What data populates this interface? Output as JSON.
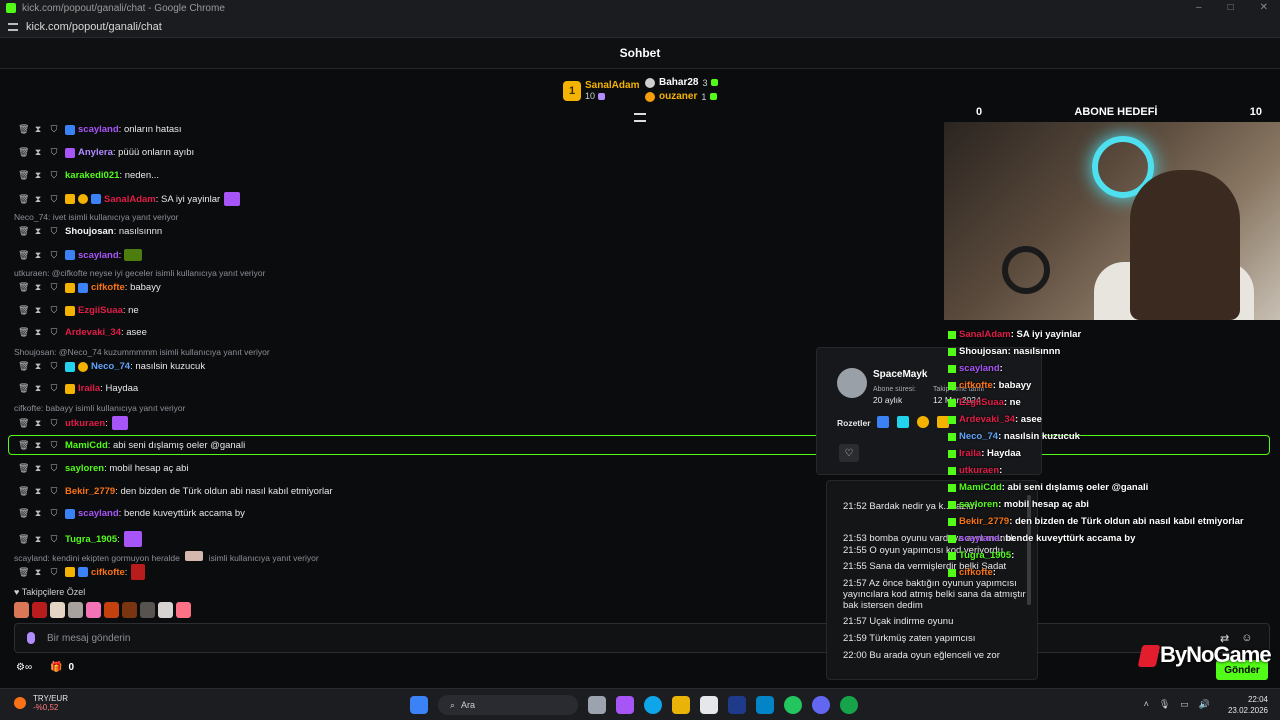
{
  "window": {
    "title": "kick.com/popout/ganali/chat - Google Chrome",
    "url": "kick.com/popout/ganali/chat",
    "controls": [
      "–",
      "□",
      "✕"
    ]
  },
  "chat_header": {
    "title": "Sohbet"
  },
  "top_gifters": {
    "main": {
      "name": "SanalAdam",
      "count": "10",
      "rank": "1"
    },
    "others": [
      {
        "name": "Bahar28",
        "count": "3"
      },
      {
        "name": "ouzaner",
        "count": "1"
      }
    ]
  },
  "messages": [
    {
      "user": "scayland",
      "user_color": "#a855f7",
      "text": ": onların hatası"
    },
    {
      "user": "Anylera",
      "user_color": "#b18cff",
      "text": ": püüü onların ayıbı"
    },
    {
      "user": "karakedi021",
      "user_color": "#53fc18",
      "text": ": neden..."
    },
    {
      "user": "SanalAdam",
      "user_color": "#e11d48",
      "text": ": SA iyi yayinlar"
    },
    {
      "user": "Shoujosan",
      "user_color": "#f5f5f5",
      "text": ": nasılsınnn"
    },
    {
      "user": "scayland",
      "user_color": "#a855f7",
      "text": ":"
    },
    {
      "user": "cifkofte",
      "user_color": "#f97316",
      "text": ": babayy"
    },
    {
      "user": "EzgiiSuaa",
      "user_color": "#e11d48",
      "text": ": ne"
    },
    {
      "user": "Ardevaki_34",
      "user_color": "#e11d48",
      "text": ": asee"
    },
    {
      "user": "Neco_74",
      "user_color": "#60a5fa",
      "text": ": nasılsin kuzucuk"
    },
    {
      "user": "Iraila",
      "user_color": "#e11d48",
      "text": ": Haydaa"
    },
    {
      "user": "utkuraen",
      "user_color": "#e11d48",
      "text": ":"
    },
    {
      "user": "MamiCdd",
      "user_color": "#53fc18",
      "text": ": abi seni dışlamış oeler @ganali"
    },
    {
      "user": "sayloren",
      "user_color": "#53fc18",
      "text": ": mobil hesap aç abi"
    },
    {
      "user": "Bekir_2779",
      "user_color": "#f97316",
      "text": ": den bizden de Türk oldun abi nasıl kabıl etmiyorlar"
    },
    {
      "user": "scayland",
      "user_color": "#a855f7",
      "text": ": bende kuveyttürk accama by"
    },
    {
      "user": "Tugra_1905",
      "user_color": "#53fc18",
      "text": ":"
    },
    {
      "user": "cifkofte",
      "user_color": "#f97316",
      "text": ":"
    }
  ],
  "replies": [
    "Neco_74: ivet isimli kullanıcıya yanıt veriyor",
    "utkuraen: @cifkofte neyse iyi geceler isimli kullanıcıya yanıt veriyor",
    "Shoujosan: @Neco_74 kuzummmmm isimli kullanıcıya yanıt veriyor",
    "cifkofte: babayy isimli kullanıcıya yanıt veriyor",
    "scayland: kendini ekipten gormuyon heralde",
    "isimli kullanıcıya yanıt veriyor"
  ],
  "followers_label": "Takipçilere Özel",
  "input": {
    "placeholder": "Bir mesaj gönderin"
  },
  "bottom": {
    "count": "0",
    "send_label": "Gönder"
  },
  "overlay": {
    "goal_left": "0",
    "goal_title": "ABONE HEDEFİ",
    "goal_right": "10",
    "chat": [
      {
        "user": "SanalAdam",
        "color": "#e11d48",
        "text": " : SA iyi yayinlar"
      },
      {
        "user": "Shoujosan",
        "color": "#ffffff",
        "text": " : nasılsınnn"
      },
      {
        "user": "scayland",
        "color": "#a855f7",
        "text": " :"
      },
      {
        "user": "cifkofte",
        "color": "#f97316",
        "text": " : babayy"
      },
      {
        "user": "EzgiiSuaa",
        "color": "#e11d48",
        "text": " : ne"
      },
      {
        "user": "Ardevaki_34",
        "color": "#e11d48",
        "text": " : asee"
      },
      {
        "user": "Neco_74",
        "color": "#60a5fa",
        "text": " : nasılsin kuzucuk"
      },
      {
        "user": "Iraila",
        "color": "#e11d48",
        "text": " : Haydaa"
      },
      {
        "user": "utkuraen",
        "color": "#e11d48",
        "text": " :"
      },
      {
        "user": "MamiCdd",
        "color": "#53fc18",
        "text": " : abi seni dışlamış oeler @ganali"
      },
      {
        "user": "sayloren",
        "color": "#53fc18",
        "text": " : mobil hesap aç abi"
      },
      {
        "user": "Bekir_2779",
        "color": "#f97316",
        "text": " : den bizden de Türk oldun abi nasıl kabıl etmiyorlar"
      },
      {
        "user": "scayland",
        "color": "#a855f7",
        "text": " : bende kuveyttürk accama by"
      },
      {
        "user": "Tugra_1905",
        "color": "#53fc18",
        "text": " :"
      },
      {
        "user": "cifkofte",
        "color": "#f97316",
        "text": " :"
      }
    ]
  },
  "profile_card": {
    "name": "SpaceMayk",
    "sub_label": "Abone süresi:",
    "sub_value": "20 aylık",
    "follow_label": "Takip etme tarihi",
    "follow_value": "12 Mar 2024",
    "badges_label": "Rozetler",
    "heart": "♡"
  },
  "history": [
    "21:52 Bardak nedir ya k... lazım",
    "21:53 bomba oyunu vardı ya aynı mantık",
    "21:55 O oyun yapımcısı kod veriyordu",
    "21:55 Sana da vermişlerdir belki Sadat",
    "21:57 Az önce baktığın oyunun yapımcısı yayıncılara kod atmış belki sana da atmıştır bak istersen dedim",
    "21:57 Uçak indirme oyunu",
    "21:59 Türkmüş zaten yapımcısı",
    "22:00 Bu arada oyun eğlenceli ve zor"
  ],
  "brand": "ByNoGame",
  "taskbar": {
    "weather_title": "TRY/EUR",
    "weather_sub": "-%0,52",
    "search_label": "Ara",
    "time": "22:04",
    "date": "23.02.2026"
  }
}
